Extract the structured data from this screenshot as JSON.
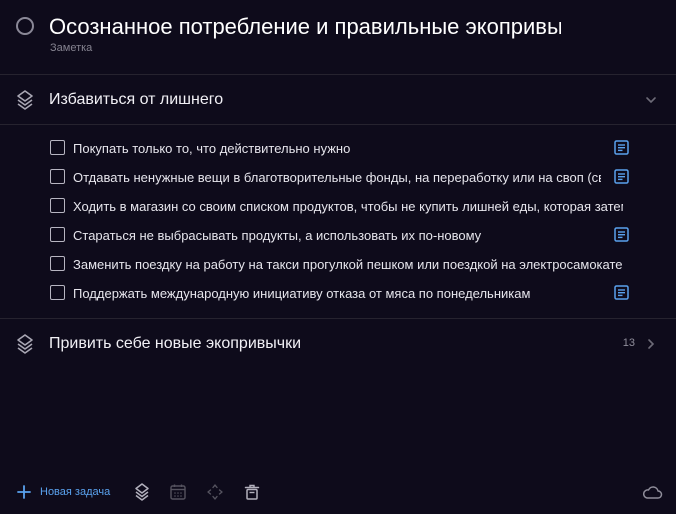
{
  "header": {
    "title": "Осознанное потребление и правильные экопривычки",
    "subtitle": "Заметка"
  },
  "sections": [
    {
      "title": "Избавиться от лишнего",
      "expanded": true,
      "items": [
        {
          "text": "Покупать только то, что действительно нужно",
          "checked": false,
          "has_note": true
        },
        {
          "text": "Отдавать ненужные вещи в благотворительные фонды, на переработку или на своп (свопинг)",
          "checked": false,
          "has_note": true
        },
        {
          "text": "Ходить в магазин со своим списком продуктов, чтобы не купить лишней еды, которая затем испортится",
          "checked": false,
          "has_note": false
        },
        {
          "text": "Стараться не выбрасывать продукты, а использовать их по-новому",
          "checked": false,
          "has_note": true
        },
        {
          "text": "Заменить поездку на работу на такси прогулкой пешком или поездкой на электросамокате",
          "checked": false,
          "has_note": false
        },
        {
          "text": "Поддержать международную инициативу отказа от мяса по понедельникам",
          "checked": false,
          "has_note": true
        }
      ]
    },
    {
      "title": "Привить себе новые экопривычки",
      "expanded": false,
      "count": "13"
    }
  ],
  "toolbar": {
    "new_task_label": "Новая задача",
    "icons": [
      "plus-icon",
      "section-icon",
      "calendar-icon",
      "move-icon",
      "trash-icon",
      "cloud-icon"
    ]
  },
  "colors": {
    "background": "#0e0b1b",
    "accent": "#5aa2ee",
    "divider": "#26232f",
    "text_primary": "#ffffff",
    "text_muted": "#84828f"
  }
}
